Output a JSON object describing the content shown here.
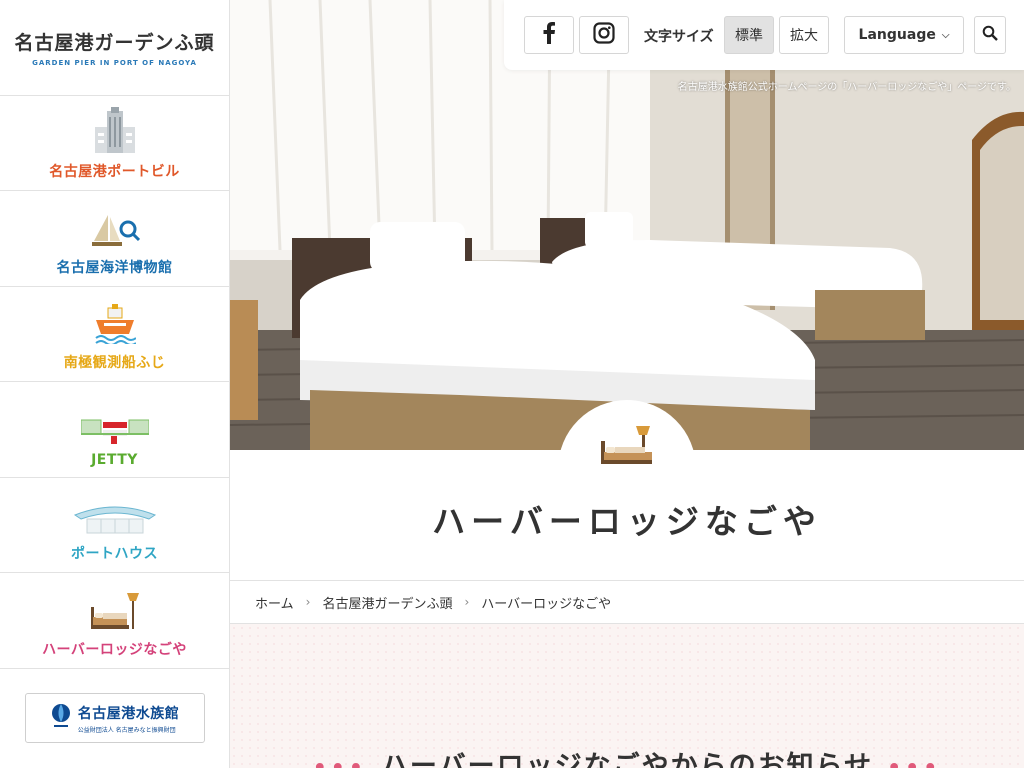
{
  "logo": {
    "title": "名古屋港ガーデンふ頭",
    "subtitle": "GARDEN PIER IN PORT OF NAGOYA"
  },
  "sidebar": {
    "items": [
      {
        "label": "名古屋港ポートビル",
        "color": "#e0582a",
        "icon": "port-building-icon"
      },
      {
        "label": "名古屋海洋博物館",
        "color": "#1a6fae",
        "icon": "maritime-museum-icon"
      },
      {
        "label": "南極観測船ふじ",
        "color": "#e6a817",
        "icon": "ship-fuji-icon"
      },
      {
        "label": "JETTY",
        "color": "#5aab2f",
        "icon": "jetty-icon"
      },
      {
        "label": "ポートハウス",
        "color": "#2fa5c4",
        "icon": "port-house-icon"
      },
      {
        "label": "ハーバーロッジなごや",
        "color": "#d4427a",
        "icon": "bed-icon"
      }
    ],
    "aquarium": {
      "title": "名古屋港水族館",
      "subtitle": "公益財団法人 名古屋みなと振興財団"
    }
  },
  "topbar": {
    "font_size_label": "文字サイズ",
    "size_normal": "標準",
    "size_large": "拡大",
    "language": "Language"
  },
  "hero": {
    "caption": "名古屋港水族館公式ホームページの「ハーバーロッジなごや」ページです。"
  },
  "page": {
    "title": "ハーバーロッジなごや"
  },
  "breadcrumb": [
    "ホーム",
    "名古屋港ガーデンふ頭",
    "ハーバーロッジなごや"
  ],
  "news": {
    "title": "ハーバーロッジなごやからのお知らせ"
  },
  "colors": {
    "accent_pink": "#e05a7a",
    "lodge_brown": "#b9844a"
  }
}
